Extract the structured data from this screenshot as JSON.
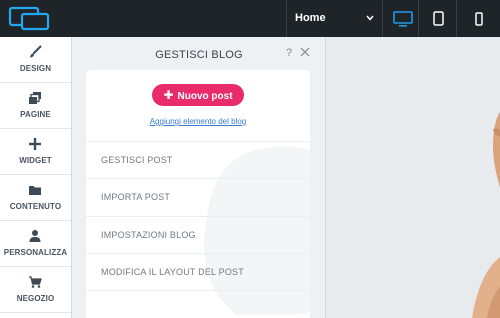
{
  "topbar": {
    "logo_icon": "site-builder-logo-icon",
    "page_selector": {
      "value": "Home"
    },
    "devices": [
      "desktop-icon",
      "tablet-icon",
      "mobile-icon"
    ],
    "active_device": "desktop",
    "accent_color": "#1e9be8"
  },
  "sidebar": {
    "items": [
      {
        "label": "DESIGN",
        "icon": "brush-icon"
      },
      {
        "label": "PAGINE",
        "icon": "pages-icon"
      },
      {
        "label": "WIDGET",
        "icon": "plus-icon"
      },
      {
        "label": "CONTENUTO",
        "icon": "folder-icon"
      },
      {
        "label": "PERSONALIZZA",
        "icon": "person-icon"
      },
      {
        "label": "NEGOZIO",
        "icon": "cart-icon"
      }
    ]
  },
  "panel": {
    "title": "GESTISCI BLOG",
    "help": "?",
    "new_post_button": "Nuovo post",
    "add_link": "Aggiungi elemento del blog",
    "menu": [
      "GESTISCI POST",
      "IMPORTA POST",
      "IMPOSTAZIONI BLOG",
      "MODIFICA IL LAYOUT DEL POST"
    ],
    "button_color": "#e92b6c"
  }
}
